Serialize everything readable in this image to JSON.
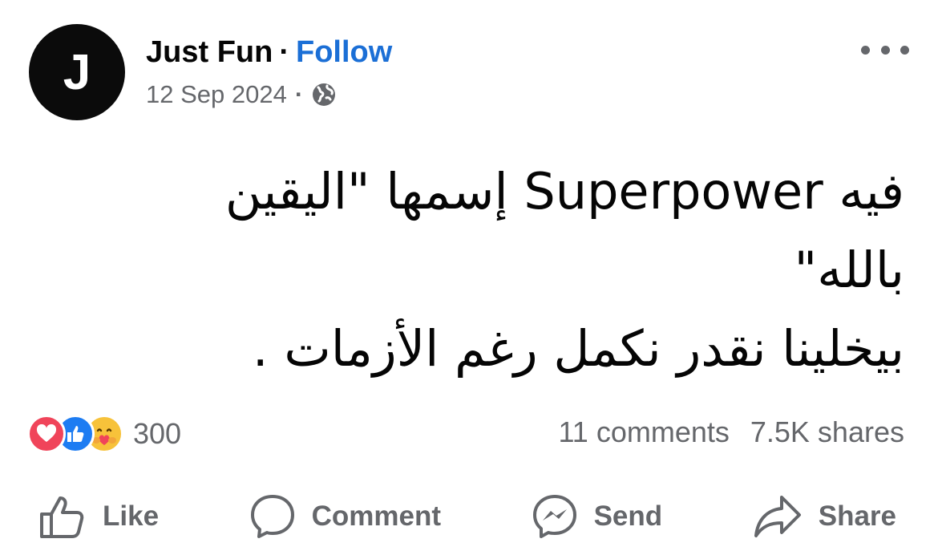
{
  "post": {
    "author": {
      "avatar_letter": "J",
      "name": "Just Fun",
      "separator": "·",
      "follow_label": "Follow"
    },
    "date": "12 Sep 2024",
    "meta_separator": "·",
    "audience_icon": "globe-icon",
    "more_icon": "more-options-icon",
    "text_lines": [
      "فيه Superpower إسمها \"اليقين",
      "بالله\"",
      "بيخلينا نقدر نكمل رغم الأزمات ."
    ]
  },
  "stats": {
    "reaction_icons": [
      "love-reaction-icon",
      "like-reaction-icon",
      "care-reaction-icon"
    ],
    "reaction_count": "300",
    "comments": "11 comments",
    "shares": "7.5K shares"
  },
  "actions": [
    {
      "label": "Like",
      "icon": "thumbs-up-icon"
    },
    {
      "label": "Comment",
      "icon": "comment-bubble-icon"
    },
    {
      "label": "Send",
      "icon": "messenger-icon"
    },
    {
      "label": "Share",
      "icon": "share-arrow-icon"
    }
  ],
  "colors": {
    "follow_blue": "#1b6fd6",
    "secondary_text": "#65676b",
    "love_red": "#f0445a",
    "like_blue": "#1d7cf2",
    "care_yellow": "#f7c23a"
  }
}
